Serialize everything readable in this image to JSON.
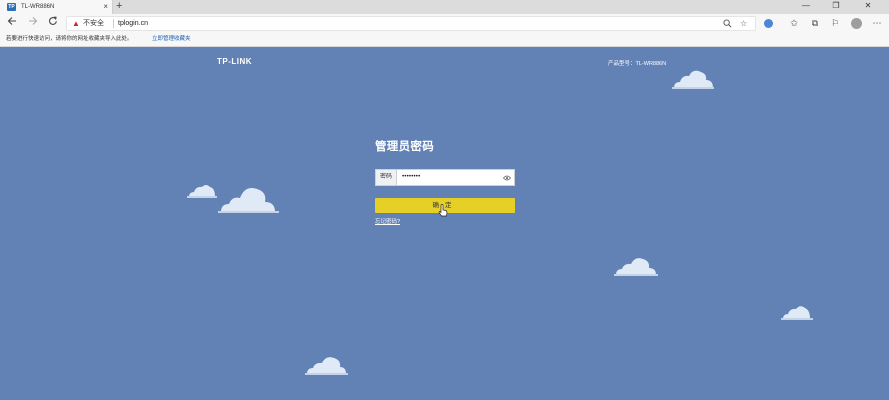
{
  "browser": {
    "tab": {
      "favicon": "TP",
      "title": "TL-WR886N",
      "close": "×"
    },
    "new_tab": "+",
    "window_controls": {
      "minimize": "—",
      "maximize": "❐",
      "close": "✕"
    },
    "address": {
      "security_icon": "warning-icon",
      "security_label": "不安全",
      "url": "tplogin.cn"
    },
    "favorites_bar": {
      "text": "若要进行快速访问，请将你的网址收藏夹导入此处。",
      "link": "立即管理收藏夹"
    },
    "icons": [
      "back-icon",
      "forward-icon",
      "refresh-icon",
      "search-icon",
      "star-icon",
      "extension-icon",
      "favorites-icon",
      "collections-icon",
      "feedback-icon",
      "profile-icon"
    ]
  },
  "page": {
    "brand": "TP-LINK",
    "model": "产品型号：TL-WR886N",
    "login": {
      "title": "管理员密码",
      "password_label": "密码",
      "password_value": "••••••••",
      "show_password_icon": "eye-icon",
      "submit": "确定",
      "forgot": "忘记密码?"
    }
  },
  "colors": {
    "background": "#6282b6",
    "button": "#e6d028",
    "cloud": "#dfeaf6"
  }
}
